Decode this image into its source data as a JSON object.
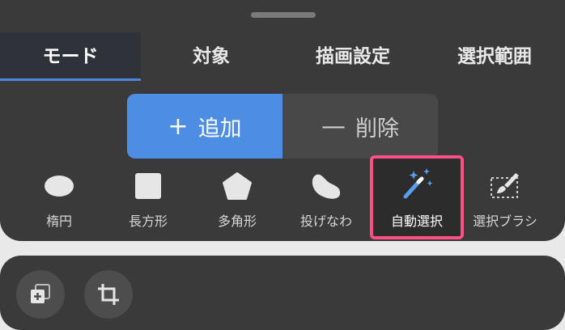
{
  "tabs": [
    {
      "label": "モード",
      "active": true
    },
    {
      "label": "対象",
      "active": false
    },
    {
      "label": "描画設定",
      "active": false
    },
    {
      "label": "選択範囲",
      "active": false
    }
  ],
  "segment": {
    "add": {
      "symbol": "+",
      "label": "追加",
      "selected": true
    },
    "delete": {
      "symbol": "—",
      "label": "削除",
      "selected": false
    }
  },
  "tools": [
    {
      "label": "楕円",
      "icon": "ellipse-icon"
    },
    {
      "label": "長方形",
      "icon": "rectangle-icon"
    },
    {
      "label": "多角形",
      "icon": "polygon-icon"
    },
    {
      "label": "投げなわ",
      "icon": "lasso-icon"
    },
    {
      "label": "自動選択",
      "icon": "magic-wand-icon",
      "selected": true
    },
    {
      "label": "選択ブラシ",
      "icon": "selection-brush-icon"
    }
  ],
  "bottom_buttons": [
    {
      "icon": "add-layer-icon"
    },
    {
      "icon": "crop-icon"
    }
  ],
  "colors": {
    "accent": "#4d8ee4",
    "highlight": "#ff4f86",
    "panel": "#3a3a3a",
    "magic_wand": "#5b9cf0"
  }
}
